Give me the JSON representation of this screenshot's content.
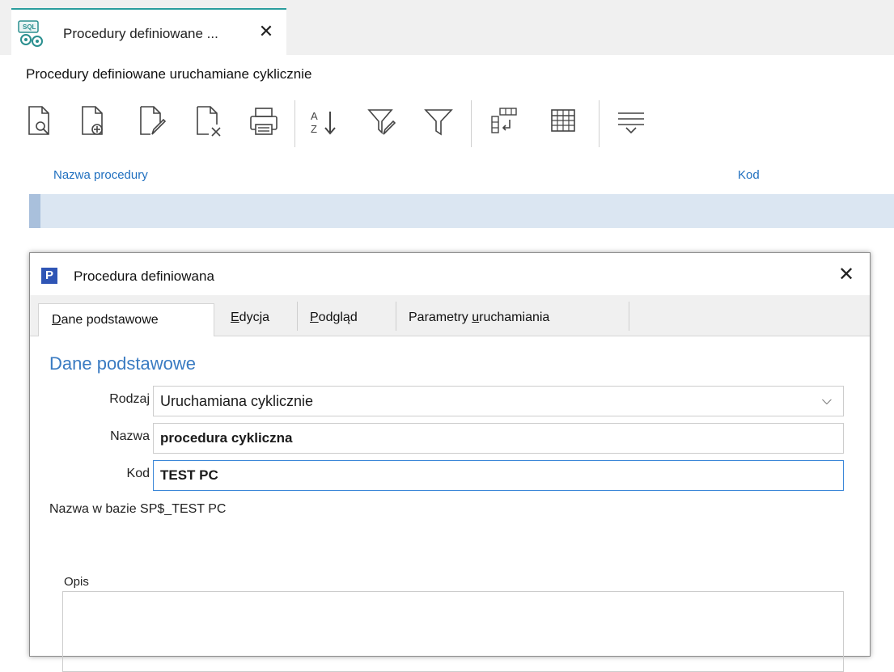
{
  "document_tab": {
    "title": "Procedury definiowane ...",
    "icon": "sql-gears-icon"
  },
  "page_heading": "Procedury definiowane uruchamiane cyklicznie",
  "toolbar": {
    "buttons": [
      {
        "icon": "preview-document-icon"
      },
      {
        "icon": "add-document-icon"
      },
      {
        "icon": "edit-document-icon"
      },
      {
        "icon": "delete-document-icon"
      },
      {
        "icon": "print-icon"
      },
      {
        "icon": "sort-az-icon"
      },
      {
        "icon": "filter-edit-icon"
      },
      {
        "icon": "filter-icon"
      },
      {
        "icon": "columns-icon"
      },
      {
        "icon": "grid-icon"
      },
      {
        "icon": "group-lines-icon"
      }
    ]
  },
  "grid": {
    "columns": [
      "Nazwa procedury",
      "Kod"
    ]
  },
  "dialog": {
    "title": "Procedura definiowana",
    "tabs": [
      {
        "label_u": "D",
        "label_rest": "ane podstawowe",
        "active": true
      },
      {
        "label_u": "E",
        "label_rest": "dycja",
        "active": false
      },
      {
        "label_u": "P",
        "label_rest": "odgląd",
        "active": false
      },
      {
        "label_pre": "Parametry ",
        "label_u": "u",
        "label_rest": "ruchamiania",
        "active": false
      }
    ],
    "section_title": "Dane podstawowe",
    "rodzaj": {
      "label": "Rodzaj",
      "value": "Uruchamiana cyklicznie"
    },
    "nazwa": {
      "label": "Nazwa",
      "value": "procedura cykliczna"
    },
    "kod": {
      "label": "Kod",
      "value": "TEST PC"
    },
    "db_name": "Nazwa w bazie SP$_TEST PC",
    "opis": {
      "label": "Opis",
      "value": ""
    }
  }
}
